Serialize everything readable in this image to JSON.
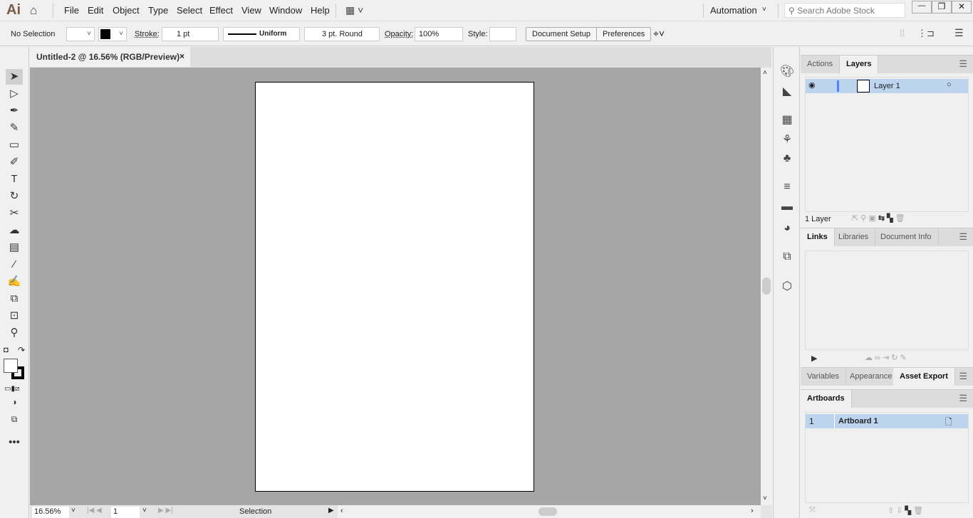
{
  "app": {
    "logo": "Ai"
  },
  "menu": [
    "File",
    "Edit",
    "Object",
    "Type",
    "Select",
    "Effect",
    "View",
    "Window",
    "Help"
  ],
  "workspace": "Automation",
  "search": {
    "placeholder": "Search Adobe Stock"
  },
  "window_controls": {
    "minimize": "—",
    "restore": "❐",
    "close": "✕"
  },
  "control": {
    "selection": "No Selection",
    "stroke_label": "Stroke:",
    "stroke_value": "1 pt",
    "profile": "Uniform",
    "brush": "3 pt. Round",
    "opacity_label": "Opacity:",
    "opacity_value": "100%",
    "style_label": "Style:",
    "document_setup": "Document Setup",
    "preferences": "Preferences"
  },
  "document": {
    "tab": "Untitled-2 @ 16.56% (RGB/Preview)",
    "close": "×"
  },
  "status": {
    "zoom": "16.56%",
    "page": "1",
    "tool": "Selection"
  },
  "layers_panel": {
    "tabs": [
      "Actions",
      "Layers"
    ],
    "active": "Layers",
    "layer_name": "Layer 1",
    "count": "1 Layer"
  },
  "links_panel": {
    "tabs": [
      "Links",
      "Libraries",
      "Document Info"
    ],
    "active": "Links"
  },
  "export_panel": {
    "tabs": [
      "Variables",
      "Appearance",
      "Asset Export"
    ],
    "active": "Asset Export"
  },
  "artboards_panel": {
    "tabs": [
      "Artboards"
    ],
    "index": "1",
    "name": "Artboard 1"
  },
  "colors": {
    "canvas": "#a6a6a6",
    "selection_row": "#bcd4ee",
    "layer_color": "#4f80ff"
  }
}
